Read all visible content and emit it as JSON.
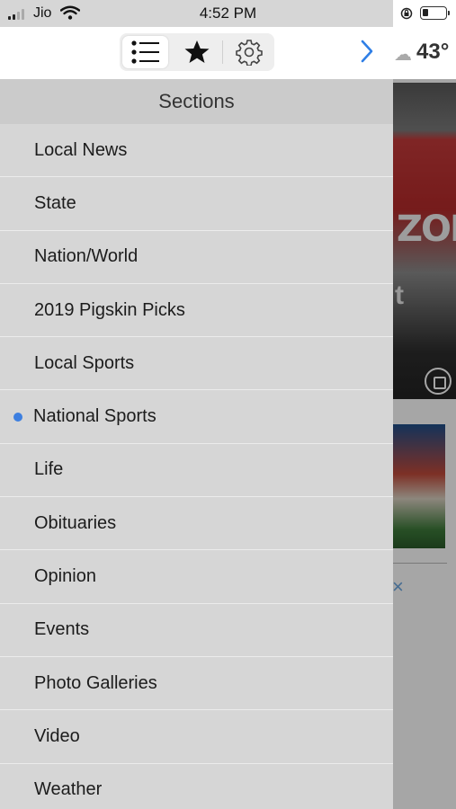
{
  "status_bar": {
    "carrier": "Jio",
    "time": "4:52 PM"
  },
  "background": {
    "temperature": "43°",
    "photo_text_1": "ZOI",
    "photo_text_2": "t",
    "close_glyph": "×"
  },
  "toolbar": {
    "tabs": [
      {
        "icon": "list-icon",
        "active": true
      },
      {
        "icon": "star-icon",
        "active": false
      },
      {
        "icon": "gear-icon",
        "active": false
      }
    ],
    "forward_icon": "chevron-right-icon"
  },
  "drawer": {
    "title": "Sections",
    "accent_color": "#3d7fe0",
    "items": [
      {
        "label": "Local News",
        "selected": false
      },
      {
        "label": "State",
        "selected": false
      },
      {
        "label": "Nation/World",
        "selected": false
      },
      {
        "label": "2019 Pigskin Picks",
        "selected": false
      },
      {
        "label": "Local Sports",
        "selected": false
      },
      {
        "label": "National Sports",
        "selected": true
      },
      {
        "label": "Life",
        "selected": false
      },
      {
        "label": "Obituaries",
        "selected": false
      },
      {
        "label": "Opinion",
        "selected": false
      },
      {
        "label": "Events",
        "selected": false
      },
      {
        "label": "Photo Galleries",
        "selected": false
      },
      {
        "label": "Video",
        "selected": false
      },
      {
        "label": "Weather",
        "selected": false
      }
    ]
  }
}
